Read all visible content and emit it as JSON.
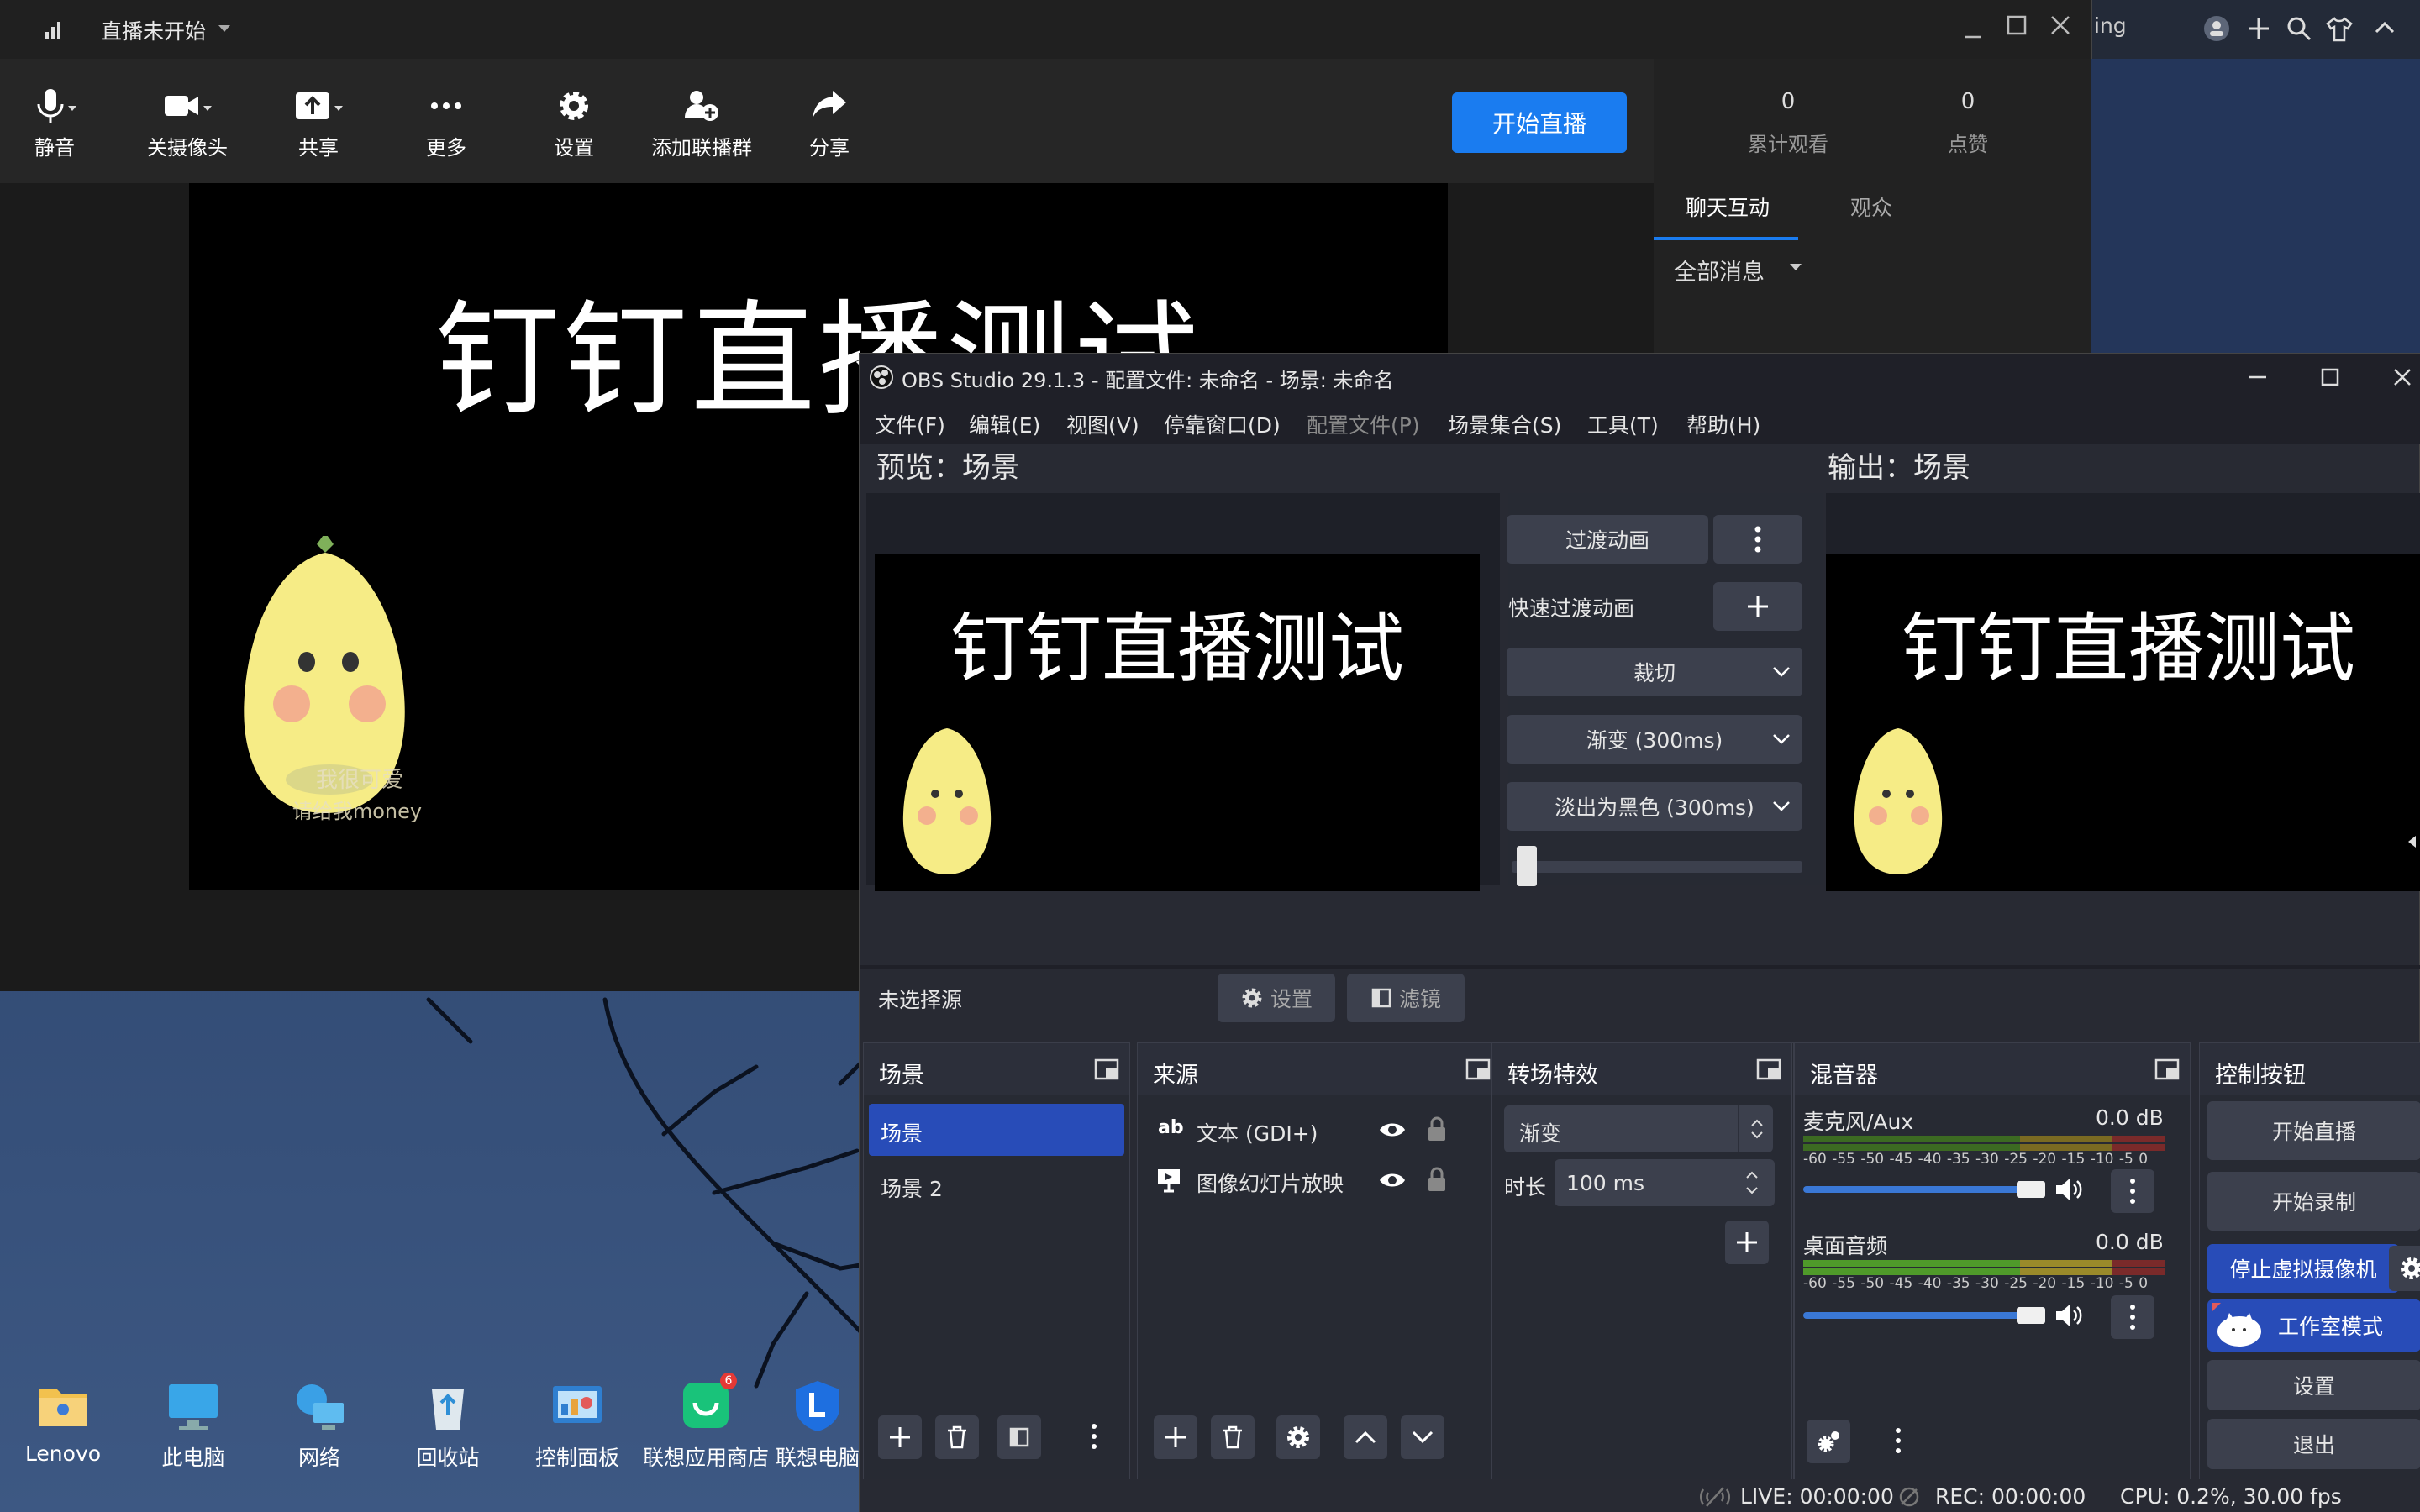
{
  "dingtalk": {
    "status": "直播未开始",
    "tools": [
      {
        "label": "静音",
        "icon": "microphone-icon"
      },
      {
        "label": "关摄像头",
        "icon": "camera-icon"
      },
      {
        "label": "共享",
        "icon": "share-screen-icon"
      },
      {
        "label": "更多",
        "icon": "more-icon"
      },
      {
        "label": "设置",
        "icon": "gear-icon"
      },
      {
        "label": "添加联播群",
        "icon": "add-group-icon"
      },
      {
        "label": "分享",
        "icon": "forward-icon"
      }
    ],
    "start_button": "开始直播",
    "stage_text": "钉钉直播测试",
    "sticker_text_1": "我很可爱",
    "sticker_text_2": "请给我money",
    "stats": [
      {
        "value": "0",
        "label": "累计观看"
      },
      {
        "value": "0",
        "label": "点赞"
      }
    ],
    "tabs": [
      "聊天互动",
      "观众"
    ],
    "filter": "全部消息"
  },
  "background_window": {
    "title_fragment": "ing"
  },
  "desktop_icons": [
    {
      "label": "Lenovo",
      "icon": "folder-icon"
    },
    {
      "label": "此电脑",
      "icon": "computer-icon"
    },
    {
      "label": "网络",
      "icon": "network-icon"
    },
    {
      "label": "回收站",
      "icon": "recycle-bin-icon"
    },
    {
      "label": "控制面板",
      "icon": "control-panel-icon"
    },
    {
      "label": "联想应用商店",
      "icon": "app-store-icon"
    },
    {
      "label": "联想电脑",
      "icon": "lenovo-pc-icon"
    }
  ],
  "app_store_badge": "6",
  "obs": {
    "title": "OBS Studio 29.1.3 - 配置文件: 未命名 - 场景: 未命名",
    "menu": [
      "文件(F)",
      "编辑(E)",
      "视图(V)",
      "停靠窗口(D)",
      "配置文件(P)",
      "场景集合(S)",
      "工具(T)",
      "帮助(H)"
    ],
    "preview_label": "预览：场景",
    "output_label": "输出：场景",
    "preview_text": "钉钉直播测试",
    "transition_button": "过渡动画",
    "quick_transition": "快速过渡动画",
    "transitions": [
      "裁切",
      "渐变 (300ms)",
      "淡出为黑色 (300ms)"
    ],
    "transition_progress": 0.02,
    "no_source": "未选择源",
    "settings_button": "设置",
    "filters_button": "滤镜",
    "scenes_title": "场景",
    "scenes": [
      "场景",
      "场景 2"
    ],
    "sources_title": "来源",
    "sources": [
      {
        "label": "文本 (GDI+)",
        "icon": "text-source-icon"
      },
      {
        "label": "图像幻灯片放映",
        "icon": "slideshow-icon"
      }
    ],
    "transitions_title": "转场特效",
    "transition_select": "渐变",
    "duration_label": "时长",
    "duration_value": "100 ms",
    "mixer_title": "混音器",
    "mixer": [
      {
        "name": "麦克风/Aux",
        "db": "0.0 dB",
        "volume": 1.0
      },
      {
        "name": "桌面音频",
        "db": "0.0 dB",
        "volume": 1.0
      }
    ],
    "meter_scale": "-60 -55 -50 -45 -40 -35 -30 -25 -20 -15 -10 -5 0",
    "controls_title": "控制按钮",
    "controls": [
      "开始直播",
      "开始录制",
      "停止虚拟摄像机",
      "工作室模式",
      "设置",
      "退出"
    ],
    "status": {
      "live": "LIVE: 00:00:00",
      "rec": "REC: 00:00:00",
      "cpu": "CPU: 0.2%, 30.00 fps"
    }
  }
}
